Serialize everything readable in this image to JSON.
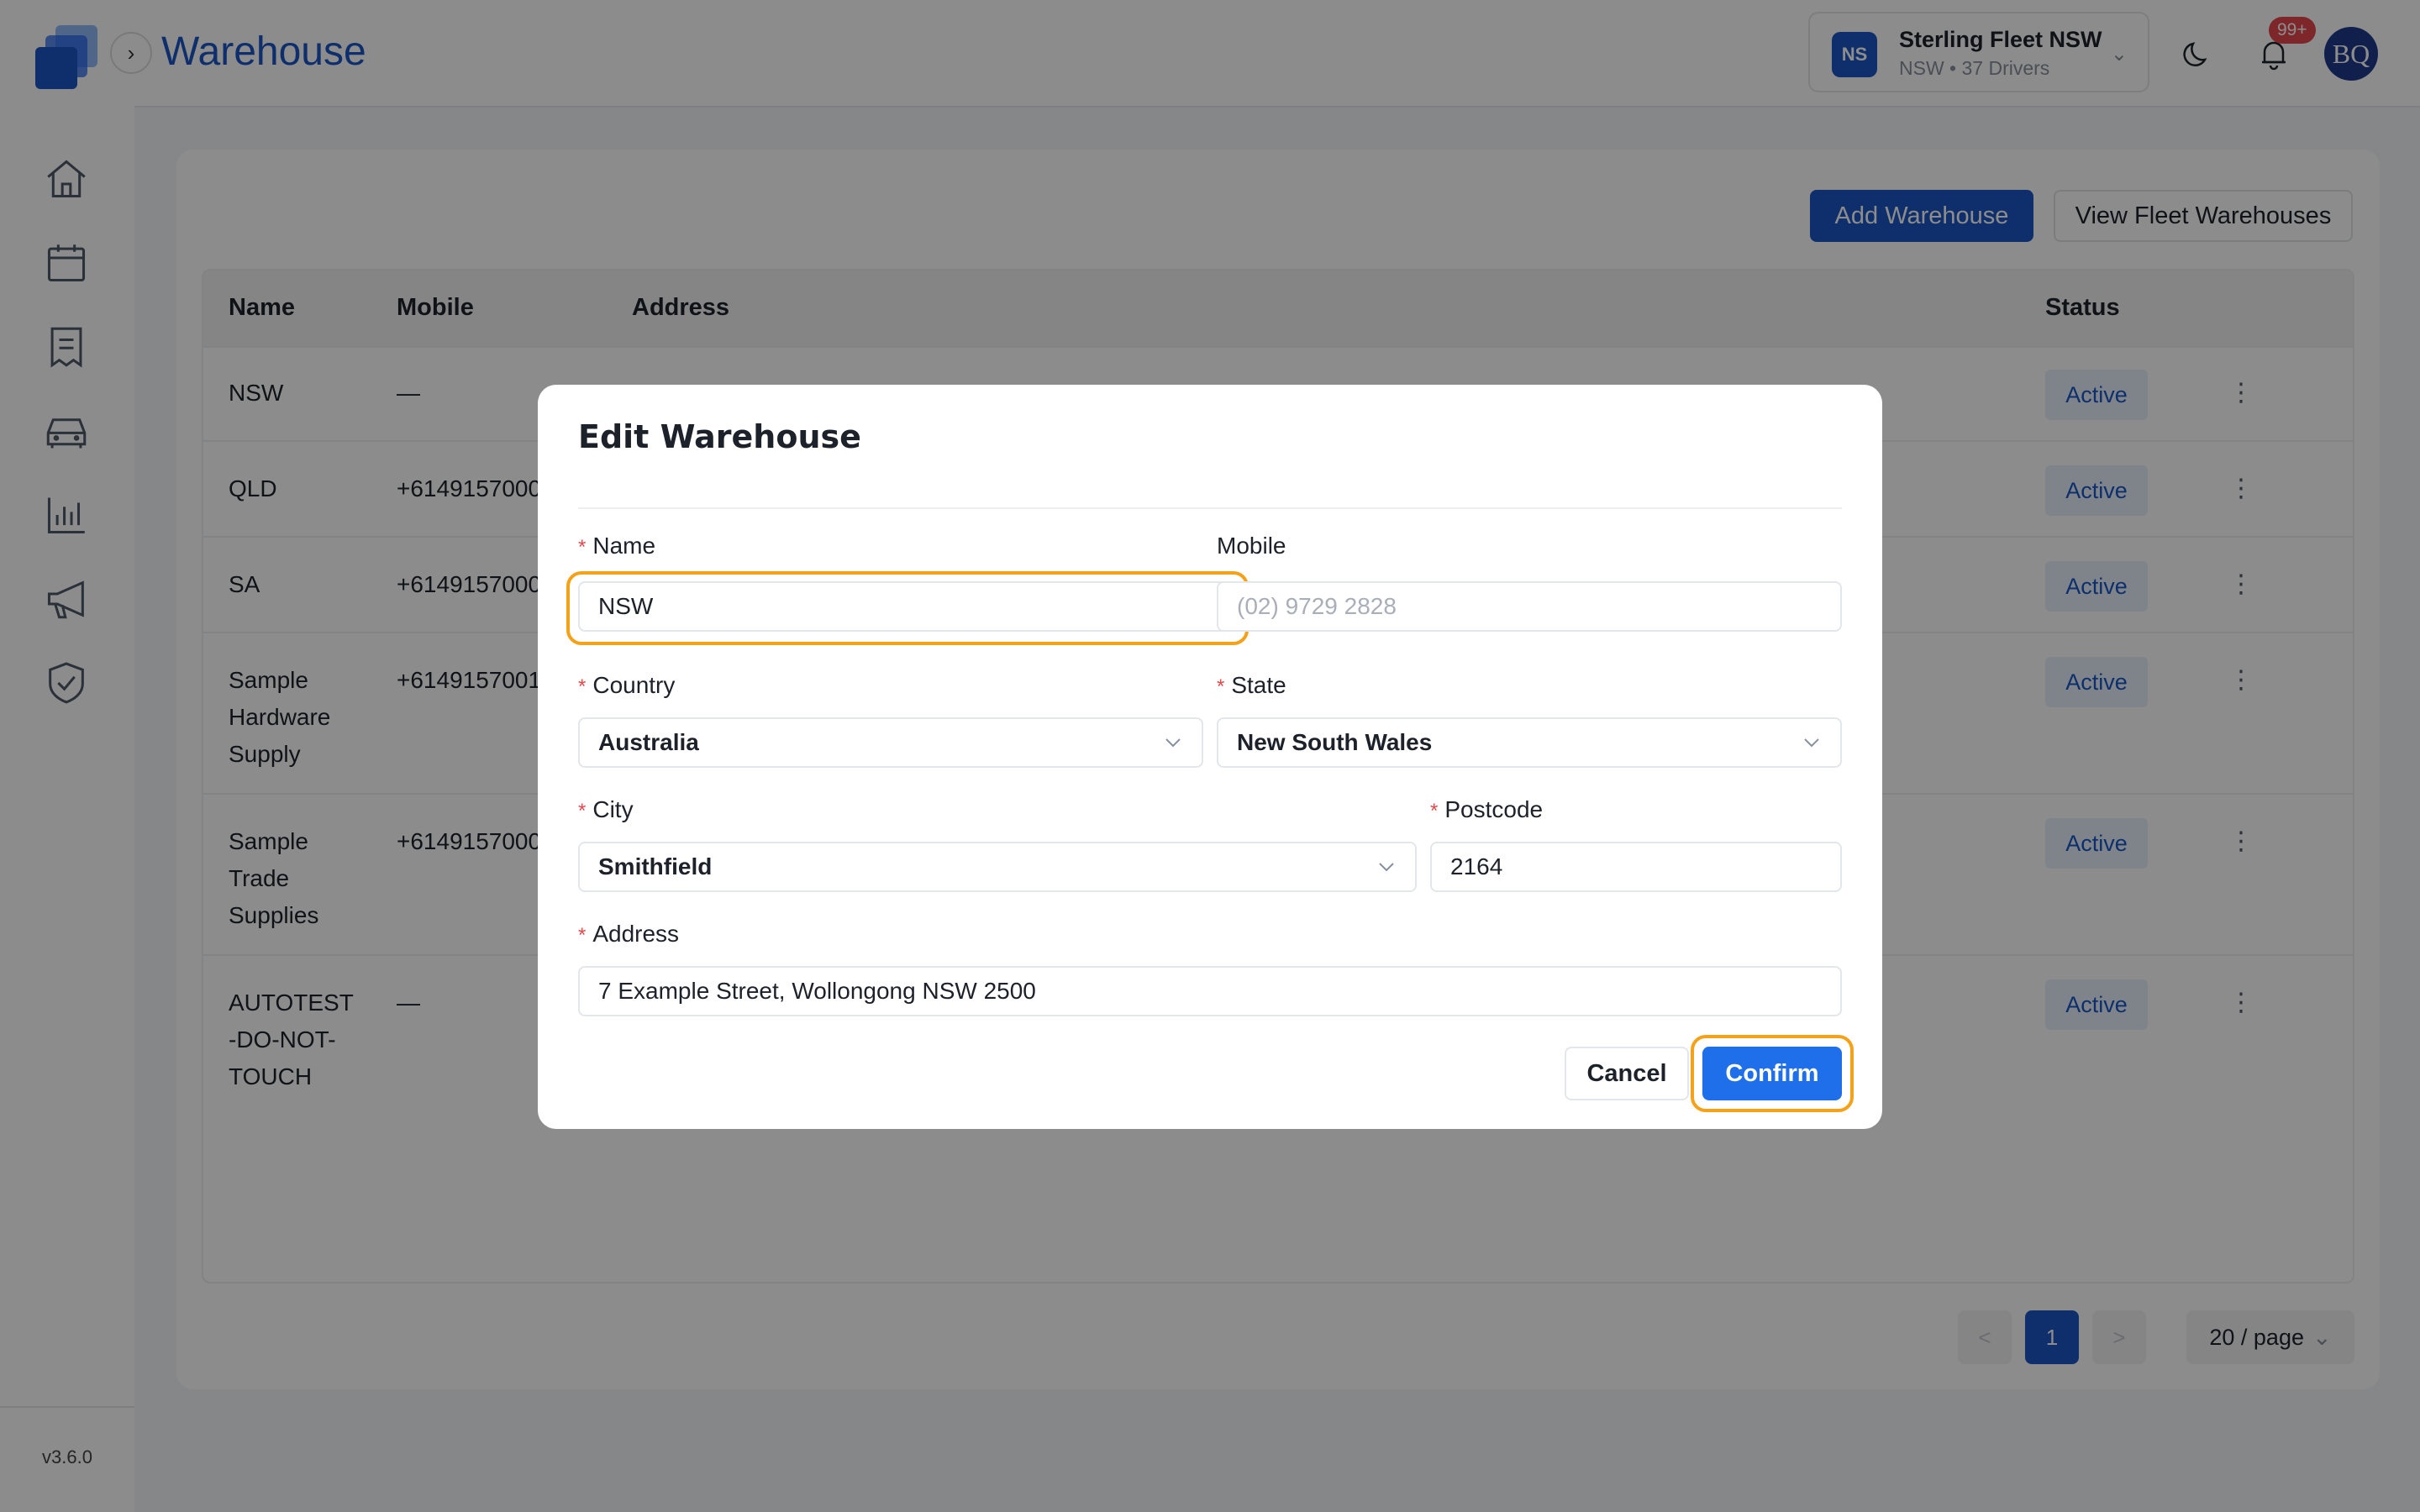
{
  "app": {
    "page_title": "Warehouse",
    "version": "v3.6.0",
    "brand_color": "#1a56c4",
    "highlight_color": "#f5a21a"
  },
  "sidebar": {
    "items": [
      {
        "icon": "home-icon"
      },
      {
        "icon": "calendar-icon"
      },
      {
        "icon": "document-icon"
      },
      {
        "icon": "car-icon"
      },
      {
        "icon": "bar-chart-icon"
      },
      {
        "icon": "megaphone-icon"
      },
      {
        "icon": "shield-check-icon"
      }
    ]
  },
  "header": {
    "fleet": {
      "initials": "NS",
      "name": "Sterling Fleet NSW",
      "sub": "NSW • 37 Drivers"
    },
    "notifications": "99+",
    "avatar": "BQ"
  },
  "toolbar": {
    "add_label": "Add Warehouse",
    "view_label": "View Fleet Warehouses"
  },
  "table": {
    "headers": {
      "name": "Name",
      "mobile": "Mobile",
      "address": "Address",
      "status": "Status"
    },
    "rows": [
      {
        "name": "NSW",
        "mobile": "—",
        "status": "Active"
      },
      {
        "name": "QLD",
        "mobile": "+6149157000",
        "status": "Active"
      },
      {
        "name": "SA",
        "mobile": "+6149157000",
        "status": "Active"
      },
      {
        "name": "Sample\nHardware\nSupply",
        "mobile": "+6149157001",
        "status": "Active"
      },
      {
        "name": "Sample\nTrade\nSupplies",
        "mobile": "+6149157000",
        "status": "Active"
      },
      {
        "name": "AUTOTEST\n-DO-NOT-\nTOUCH",
        "mobile": "—",
        "status": "Active"
      }
    ]
  },
  "pagination": {
    "current": "1",
    "page_size": "20 / page",
    "prev": "<",
    "next": ">"
  },
  "modal": {
    "title": "Edit Warehouse",
    "fields": {
      "name": {
        "label": "Name",
        "value": "NSW"
      },
      "mobile": {
        "label": "Mobile",
        "placeholder": "(02) 9729 2828"
      },
      "country": {
        "label": "Country",
        "value": "Australia"
      },
      "state": {
        "label": "State",
        "value": "New South Wales"
      },
      "city": {
        "label": "City",
        "value": "Smithfield"
      },
      "postcode": {
        "label": "Postcode",
        "value": "2164"
      },
      "address": {
        "label": "Address",
        "value": "7 Example Street, Wollongong NSW 2500"
      }
    },
    "cancel_label": "Cancel",
    "confirm_label": "Confirm"
  }
}
